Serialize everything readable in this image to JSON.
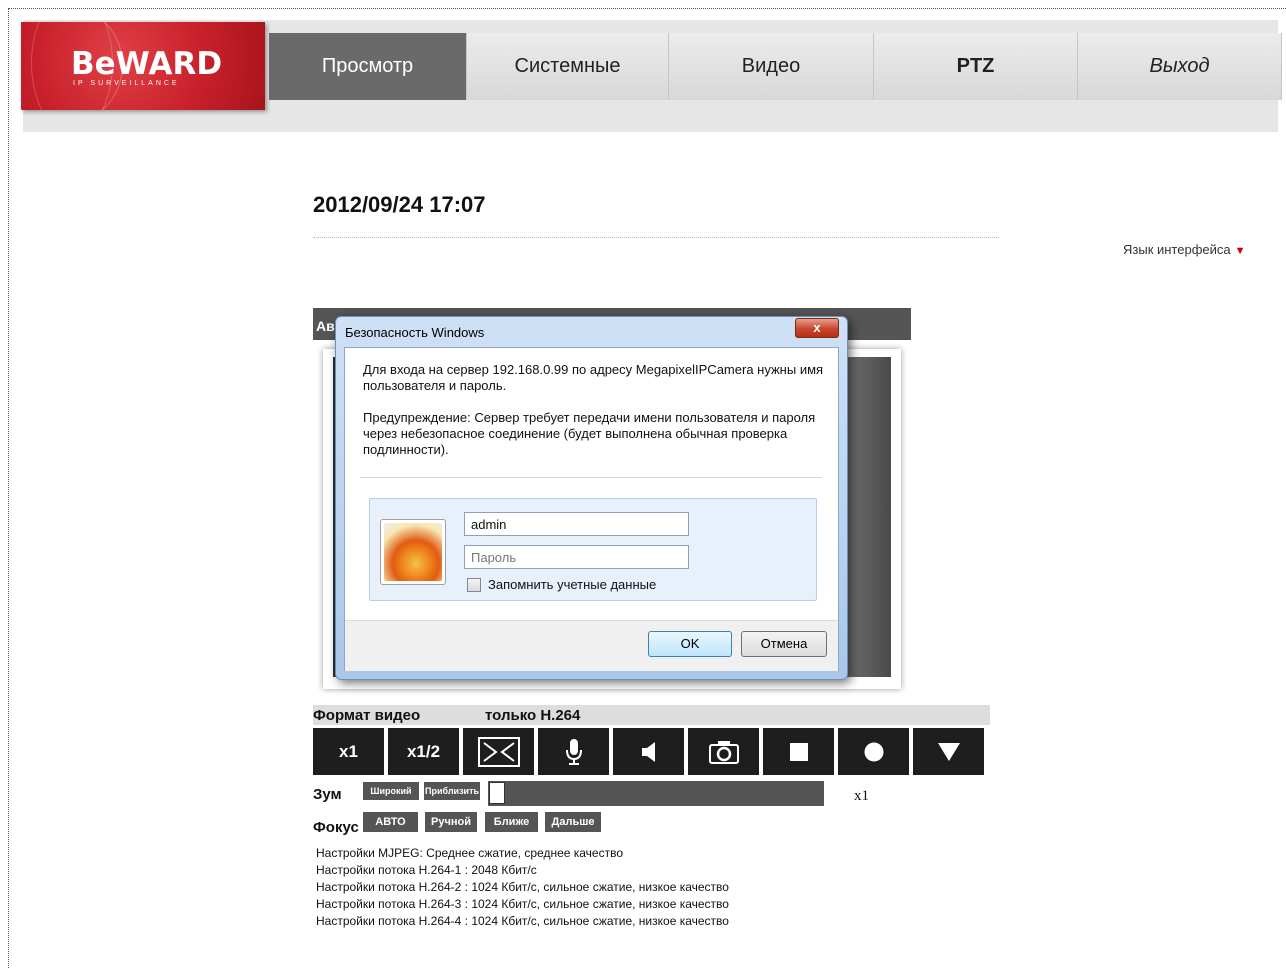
{
  "logo": {
    "brand": "BeWARD",
    "tagline": "IP SURVEILLANCE"
  },
  "nav": [
    {
      "label": "Просмотр",
      "active": true
    },
    {
      "label": "Системные"
    },
    {
      "label": "Видео"
    },
    {
      "label": "PTZ"
    },
    {
      "label": "Выход"
    }
  ],
  "datetime": "2012/09/24 17:07",
  "language_link": "Язык интерфейса",
  "video_bar_title": "Ав",
  "dialog": {
    "title": "Безопасность Windows",
    "close_label": "x",
    "message_1": "Для входа на сервер 192.168.0.99  по адресу MegapixelIPCamera нужны имя пользователя и пароль.",
    "message_2": "Предупреждение: Сервер требует передачи имени пользователя и пароля через небезопасное соединение (будет выполнена обычная проверка подлинности).",
    "username_value": "admin",
    "password_placeholder": "Пароль",
    "remember_label": "Запомнить учетные данные",
    "ok_label": "OK",
    "cancel_label": "Отмена"
  },
  "format": {
    "label": "Формат видео",
    "value": "только H.264"
  },
  "controls": {
    "x1": "x1",
    "x12": "x1/2"
  },
  "zoom": {
    "label": "Зум",
    "wide": "Широкий",
    "near": "Приблизить",
    "value": "x1",
    "level": 0
  },
  "focus": {
    "label": "Фокус",
    "auto": "АВТО",
    "manual": "Ручной",
    "closer": "Ближе",
    "farther": "Дальше"
  },
  "settings": [
    "Настройки MJPEG: Среднее сжатие, среднее качество",
    "Настройки потока H.264-1 : 2048 Кбит/с",
    "Настройки потока H.264-2 : 1024 Кбит/с, сильное сжатие, низкое качество",
    "Настройки потока H.264-3 : 1024 Кбит/с, сильное сжатие, низкое качество",
    "Настройки потока H.264-4 : 1024 Кбит/с, сильное сжатие, низкое качество"
  ]
}
